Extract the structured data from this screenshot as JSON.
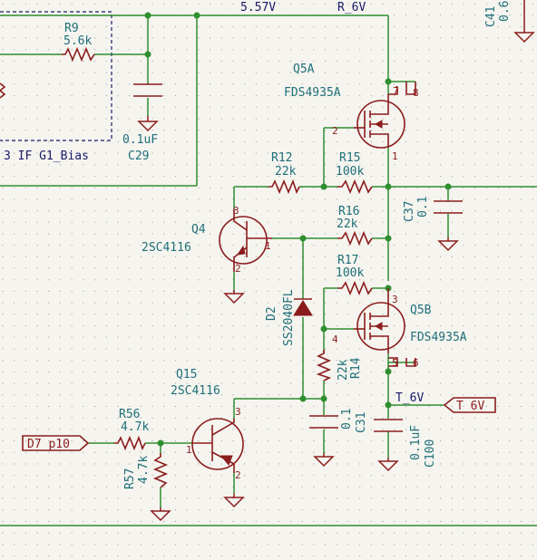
{
  "nets": {
    "supply_5v57": "5.57V",
    "r_6v": "R_6V",
    "t_6v": "T_6V"
  },
  "sheet": {
    "label": "3 IF G1_Bias"
  },
  "global_labels": {
    "t6v": "T_6V",
    "d7": "D7_p10"
  },
  "parts": {
    "r9": {
      "ref": "R9",
      "value": "5.6k"
    },
    "c29": {
      "ref": "C29",
      "value": "0.1uF"
    },
    "c41": {
      "ref": "C41",
      "value": "0.6"
    },
    "q5a": {
      "ref": "Q5A",
      "value": "FDS4935A",
      "pins": [
        "7",
        "8",
        "2",
        "1"
      ]
    },
    "r12": {
      "ref": "R12",
      "value": "22k"
    },
    "r15": {
      "ref": "R15",
      "value": "100k"
    },
    "c37": {
      "ref": "C37",
      "value": "0.1"
    },
    "q4": {
      "ref": "Q4",
      "value": "2SC4116",
      "pins": [
        "3",
        "1",
        "2"
      ]
    },
    "r16": {
      "ref": "R16",
      "value": "22k"
    },
    "d2": {
      "ref": "D2",
      "value": "SS2040FL"
    },
    "r17": {
      "ref": "R17",
      "value": "100k"
    },
    "q5b": {
      "ref": "Q5B",
      "value": "FDS4935A",
      "pins": [
        "3",
        "4",
        "5",
        "6"
      ]
    },
    "r14": {
      "ref": "R14",
      "value": "22k"
    },
    "q15": {
      "ref": "Q15",
      "value": "2SC4116",
      "pins": [
        "3",
        "1",
        "2"
      ]
    },
    "c31": {
      "ref": "C31",
      "value": "0.1"
    },
    "c100": {
      "ref": "C100",
      "value": "0.1uF"
    },
    "r56": {
      "ref": "R56",
      "value": "4.7k"
    },
    "r57": {
      "ref": "R57",
      "value": "4.7k"
    }
  }
}
